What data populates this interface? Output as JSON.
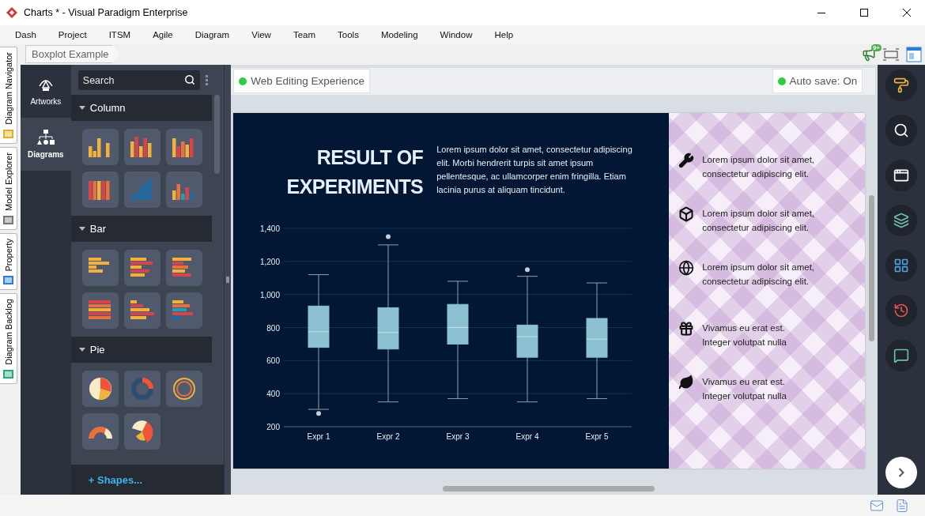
{
  "window": {
    "title": "Charts * - Visual Paradigm Enterprise"
  },
  "menu": [
    "Dash",
    "Project",
    "ITSM",
    "Agile",
    "Diagram",
    "View",
    "Team",
    "Tools",
    "Modeling",
    "Window",
    "Help"
  ],
  "side_tabs": [
    {
      "label": "Diagram Navigator"
    },
    {
      "label": "Model Explorer"
    },
    {
      "label": "Property"
    },
    {
      "label": "Diagram Backlog"
    }
  ],
  "breadcrumb": "Boxplot Example",
  "notifications": {
    "badge": "9+"
  },
  "nav": [
    {
      "label": "Artworks",
      "selected": false
    },
    {
      "label": "Diagrams",
      "selected": true
    }
  ],
  "search": {
    "placeholder": "Search"
  },
  "sections": [
    {
      "title": "Column",
      "expanded": true
    },
    {
      "title": "Bar",
      "expanded": true
    },
    {
      "title": "Pie",
      "expanded": true
    }
  ],
  "shapes_link": "+ Shapes...",
  "status_badges": [
    {
      "label": "Web Editing Experience",
      "on": true
    },
    {
      "label": "Auto save: On",
      "on": true
    }
  ],
  "slide": {
    "title": "RESULT OF\nEXPERIMENTS",
    "body": "Lorem ipsum dolor sit amet, consectetur adipiscing elit. Morbi hendrerit turpis sit amet ipsum pellentesque, ac ullamcorper enim fringilla. Etiam lacinia purus at aliquam tincidunt.",
    "chart_data": {
      "type": "box",
      "grid": true,
      "categories": [
        "Expr 1",
        "Expr 2",
        "Expr 3",
        "Expr 4",
        "Expr 5"
      ],
      "ylim": [
        200,
        1400
      ],
      "yticks": [
        {
          "value": 200,
          "label": "200"
        },
        {
          "value": 400,
          "label": "400"
        },
        {
          "value": 600,
          "label": "600"
        },
        {
          "value": 800,
          "label": "800"
        },
        {
          "value": 1000,
          "label": "1,000"
        },
        {
          "value": 1200,
          "label": "1,200"
        },
        {
          "value": 1400,
          "label": "1,400"
        }
      ],
      "boxes": [
        {
          "low": 305,
          "q1": 680,
          "median": 775,
          "q3": 930,
          "high": 1120,
          "outliers": [
            280
          ]
        },
        {
          "low": 350,
          "q1": 670,
          "median": 770,
          "q3": 920,
          "high": 1300,
          "outliers": [
            1350
          ]
        },
        {
          "low": 370,
          "q1": 700,
          "median": 800,
          "q3": 940,
          "high": 1080
        },
        {
          "low": 350,
          "q1": 620,
          "median": 745,
          "q3": 815,
          "high": 1110,
          "outliers": [
            1150
          ]
        },
        {
          "low": 370,
          "q1": 620,
          "median": 730,
          "q3": 855,
          "high": 1070
        }
      ]
    },
    "feature_groups": [
      [
        {
          "kind": "tools",
          "text": "Lorem ipsum dolor sit amet,\nconsectetur adipiscing elit."
        },
        {
          "kind": "cube",
          "text": "Lorem ipsum dolor sit amet,\nconsectetur adipiscing elit."
        },
        {
          "kind": "globe",
          "text": "Lorem ipsum dolor sit amet,\nconsectetur adipiscing elit."
        }
      ],
      [
        {
          "kind": "gift",
          "text": "Vivamus eu erat est.\nInteger volutpat nulla"
        },
        {
          "kind": "leaf",
          "text": "Vivamus eu erat est.\nInteger volutpat nulla"
        }
      ]
    ]
  }
}
